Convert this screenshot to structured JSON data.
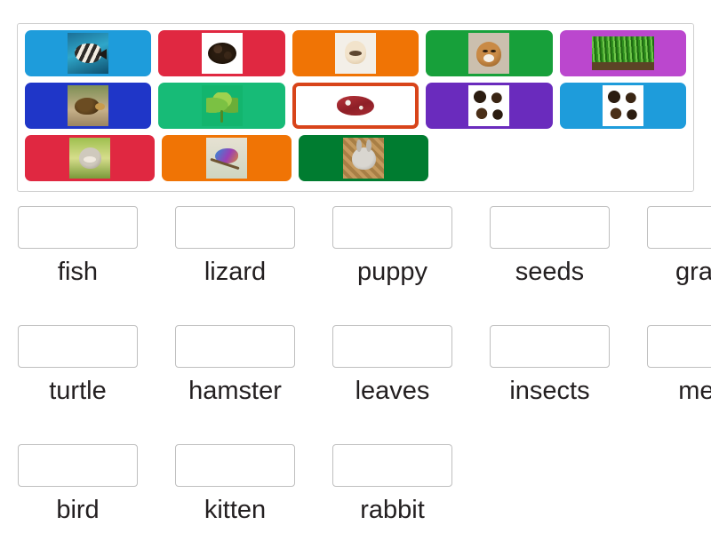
{
  "activity": {
    "type": "match-up-drag-and-drop",
    "selected_tile": "meat",
    "selection_border_color": "#d8441a"
  },
  "tile_bank": {
    "rows": [
      [
        {
          "id": "fish",
          "image": "angelfish-photo",
          "color": "#1e9cdb"
        },
        {
          "id": "seeds",
          "image": "seed-pile-photo",
          "color": "#e02841"
        },
        {
          "id": "puppy",
          "image": "puppy-photo",
          "color": "#f07405"
        },
        {
          "id": "hamster",
          "image": "hamster-photo",
          "color": "#17a03a"
        },
        {
          "id": "grass",
          "image": "grass-photo",
          "color": "#bb47ce"
        }
      ],
      [
        {
          "id": "turtle",
          "image": "turtle-photo",
          "color": "#1f36c8"
        },
        {
          "id": "leaves",
          "image": "green-leaves-photo",
          "color": "#17bb77"
        },
        {
          "id": "meat",
          "image": "raw-meat-photo",
          "color": "#ffffff",
          "selected": true
        },
        {
          "id": "insects",
          "image": "insects-photo",
          "color": "#6a2bbd"
        },
        {
          "id": "bugs",
          "image": "insects-collage-photo",
          "color": "#1e9cdb"
        }
      ],
      [
        {
          "id": "kitten",
          "image": "kitten-photo",
          "color": "#e02841"
        },
        {
          "id": "bird",
          "image": "colorful-bird-photo",
          "color": "#f07405"
        },
        {
          "id": "rabbit",
          "image": "rabbit-photo",
          "color": "#007c30"
        }
      ]
    ]
  },
  "answers": {
    "rows": [
      [
        {
          "label": "fish",
          "value": ""
        },
        {
          "label": "lizard",
          "value": ""
        },
        {
          "label": "puppy",
          "value": ""
        },
        {
          "label": "seeds",
          "value": ""
        },
        {
          "label": "grass",
          "value": ""
        }
      ],
      [
        {
          "label": "turtle",
          "value": ""
        },
        {
          "label": "hamster",
          "value": ""
        },
        {
          "label": "leaves",
          "value": ""
        },
        {
          "label": "insects",
          "value": ""
        },
        {
          "label": "meat",
          "value": ""
        }
      ],
      [
        {
          "label": "bird",
          "value": ""
        },
        {
          "label": "kitten",
          "value": ""
        },
        {
          "label": "rabbit",
          "value": ""
        }
      ]
    ]
  }
}
